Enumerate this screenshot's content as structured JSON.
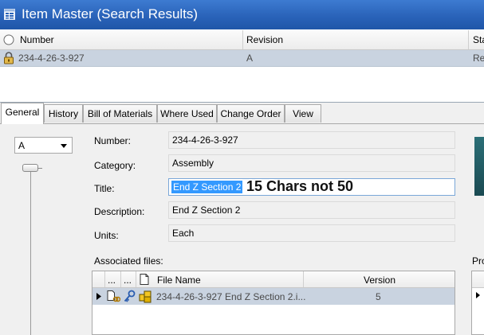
{
  "window": {
    "title": "Item Master   (Search Results)"
  },
  "grid": {
    "columns": [
      "Number",
      "Revision",
      "Sta"
    ],
    "rows": [
      {
        "number": "234-4-26-3-927",
        "revision": "A",
        "status": "Rel"
      }
    ]
  },
  "tabs": [
    {
      "label": "General",
      "active": true
    },
    {
      "label": "History"
    },
    {
      "label": "Bill of Materials"
    },
    {
      "label": "Where Used"
    },
    {
      "label": "Change Order"
    },
    {
      "label": "View"
    }
  ],
  "general": {
    "revision_select": "A",
    "fields": [
      {
        "label": "Number:",
        "value": "234-4-26-3-927"
      },
      {
        "label": "Category:",
        "value": "Assembly"
      },
      {
        "label": "Title:",
        "value": "End Z Section 2"
      },
      {
        "label": "Description:",
        "value": "End Z Section 2"
      },
      {
        "label": "Units:",
        "value": "Each"
      }
    ],
    "annotation": "15 Chars not 50",
    "associated_files": {
      "label": "Associated files:",
      "columns": {
        "c1": "...",
        "c2": "...",
        "file_name": "File Name",
        "version": "Version"
      },
      "rows": [
        {
          "file_name": "234-4-26-3-927 End Z Section 2.i...",
          "version": "5"
        }
      ]
    },
    "right_label": "Pro"
  },
  "icons": [
    "app-window-icon",
    "radio-icon",
    "lock-icon",
    "dropdown-arrow-icon",
    "file-icon",
    "key-icon",
    "assembly-icon",
    "row-pointer-icon"
  ]
}
